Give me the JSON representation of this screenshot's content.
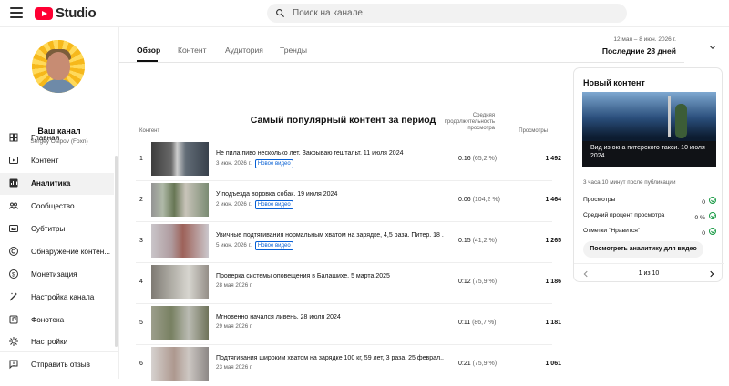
{
  "app": {
    "name": "Studio"
  },
  "search": {
    "placeholder": "Поиск на канале"
  },
  "sidebar": {
    "channel": "Ваш канал",
    "owner": "Sergey Osipov (Foxn)",
    "items": [
      {
        "label": "Главная",
        "icon": "dashboard-icon"
      },
      {
        "label": "Контент",
        "icon": "content-icon"
      },
      {
        "label": "Аналитика",
        "icon": "analytics-icon"
      },
      {
        "label": "Сообщество",
        "icon": "community-icon"
      },
      {
        "label": "Субтитры",
        "icon": "subtitles-icon"
      },
      {
        "label": "Обнаружение контен...",
        "icon": "copyright-icon"
      },
      {
        "label": "Монетизация",
        "icon": "money-icon"
      },
      {
        "label": "Настройка канала",
        "icon": "magic-icon"
      },
      {
        "label": "Фонотека",
        "icon": "library-icon"
      },
      {
        "label": "Настройки",
        "icon": "settings-icon"
      },
      {
        "label": "Отправить отзыв",
        "icon": "feedback-icon"
      }
    ]
  },
  "tabs": [
    "Обзор",
    "Контент",
    "Аудитория",
    "Тренды"
  ],
  "date_range": {
    "dates": "12 мая – 8 июн. 2026 г.",
    "label": "Последние 28 дней"
  },
  "main": {
    "title": "Самый популярный контент за период",
    "col_content": "Контент",
    "col_avg": "Средняя продолжительность просмотра",
    "col_views": "Просмотры",
    "rows": [
      {
        "idx": "1",
        "title": "Не пила пиво несколько лет. Закрываю гештальт. 11 июля 2024",
        "date": "3 июн. 2026 г.",
        "badge": "Новое видео",
        "avg": "0:16",
        "avg_pct": "(65,2 %)",
        "views": "1 492",
        "thumb": "#5d6a76"
      },
      {
        "idx": "2",
        "title": "У подъезда воровка собак. 19 июля 2024",
        "date": "2 июн. 2026 г.",
        "badge": "Новое видео",
        "avg": "0:06",
        "avg_pct": "(104,2 %)",
        "views": "1 464",
        "thumb": "#7b8f72"
      },
      {
        "idx": "3",
        "title": "Увичные подтягивания нормальным хватом на зарядке, 4,5 раза. Питер. 18 ...",
        "date": "5 июн. 2026 г.",
        "badge": "Новое видео",
        "avg": "0:15",
        "avg_pct": "(41,2 %)",
        "views": "1 265",
        "thumb": "#b99b9a"
      },
      {
        "idx": "4",
        "title": "Проверка системы оповещения в Балашихе. 5 марта 2025",
        "date": "28 мая 2026 г.",
        "badge": "",
        "avg": "0:12",
        "avg_pct": "(75,9 %)",
        "views": "1 186",
        "thumb": "#9c9a94"
      },
      {
        "idx": "5",
        "title": "Мгновенно начался ливень. 28 июля 2024",
        "date": "29 мая 2026 г.",
        "badge": "",
        "avg": "0:11",
        "avg_pct": "(86,7 %)",
        "views": "1 181",
        "thumb": "#7d8663"
      },
      {
        "idx": "6",
        "title": "Подтягивания широким хватом на зарядке 100 кг, 59 лет, 3 раза. 25 феврал...",
        "date": "23 мая 2026 г.",
        "badge": "",
        "avg": "0:21",
        "avg_pct": "(75,9 %)",
        "views": "1 061",
        "thumb": "#a39d9a"
      }
    ]
  },
  "card": {
    "title": "Новый контент",
    "caption": "Вид из окна питерского такси. 10 июля 2024",
    "time_ago": "3 часа 10 минут после публикации",
    "stats": [
      {
        "label": "Просмотры",
        "value": "0"
      },
      {
        "label": "Средний процент просмотра",
        "value": "0 %"
      },
      {
        "label": "Отметки \"Нравится\"",
        "value": "0"
      }
    ],
    "button": "Посмотреть аналитику для видео",
    "pager": "1 из 10"
  }
}
